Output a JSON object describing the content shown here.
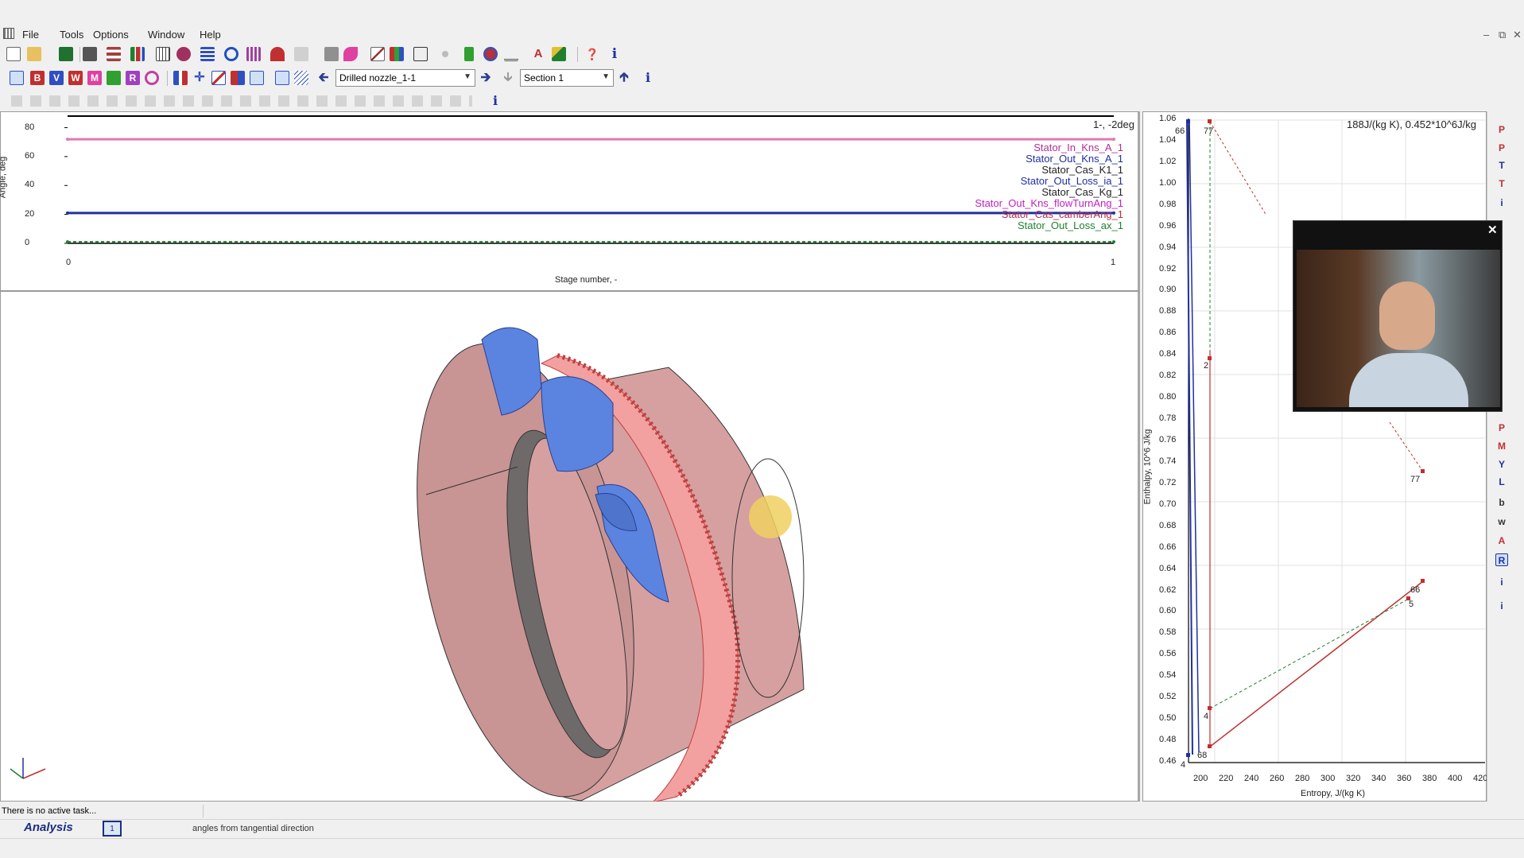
{
  "menu": {
    "file": "File",
    "tools": "Tools",
    "options": "Options",
    "window": "Window",
    "help": "Help"
  },
  "toolbar2": {
    "model_select": "Drilled nozzle_1-1",
    "section_select": "Section 1"
  },
  "top_chart": {
    "ylabel": "Angle, deg",
    "xlabel": "Stage number, -",
    "corner_label": "1-, -2deg",
    "y_ticks": [
      "80",
      "60",
      "40",
      "20",
      "0"
    ],
    "x_ticks": [
      "0",
      "1"
    ],
    "legend": [
      {
        "label": "Stator_In_Kns_A_1",
        "color": "#b03090"
      },
      {
        "label": "Stator_Out_Kns_A_1",
        "color": "#2030a0"
      },
      {
        "label": "Stator_Cas_K1_1",
        "color": "#222222"
      },
      {
        "label": "Stator_Out_Loss_ia_1",
        "color": "#2030a0"
      },
      {
        "label": "Stator_Cas_Kg_1",
        "color": "#222222"
      },
      {
        "label": "Stator_Out_Kns_flowTurnAng_1",
        "color": "#c020c0"
      },
      {
        "label": "Stator_Cas_camberAng_1",
        "color": "#b03050"
      },
      {
        "label": "Stator_Out_Loss_ax_1",
        "color": "#208030"
      }
    ]
  },
  "chart_data": {
    "type": "line",
    "title": "",
    "xlabel": "Stage number, -",
    "ylabel": "Angle, deg",
    "xlim": [
      0,
      1
    ],
    "ylim": [
      0,
      88
    ],
    "series": [
      {
        "name": "Stator_In_Kns_A_1",
        "x": [
          0,
          1
        ],
        "values": [
          72,
          72
        ],
        "color": "#e07ab0"
      },
      {
        "name": "Stator_Out_Kns_A_1",
        "x": [
          0,
          1
        ],
        "values": [
          21,
          21
        ],
        "color": "#2030a0"
      },
      {
        "name": "Stator_Out_Loss_ax_1",
        "x": [
          0,
          1
        ],
        "values": [
          1,
          1
        ],
        "color": "#208030"
      }
    ]
  },
  "hs_chart": {
    "ylabel": "Enthalpy, 10^6 J/kg",
    "xlabel": "Entropy, J/(kg K)",
    "corner_label": "188J/(kg K), 0.452*10^6J/kg",
    "y_ticks": [
      "1.06",
      "1.04",
      "1.02",
      "1.00",
      "0.98",
      "0.96",
      "0.94",
      "0.92",
      "0.90",
      "0.88",
      "0.86",
      "0.84",
      "0.82",
      "0.80",
      "0.78",
      "0.76",
      "0.74",
      "0.72",
      "0.70",
      "0.68",
      "0.66",
      "0.64",
      "0.62",
      "0.60",
      "0.58",
      "0.56",
      "0.54",
      "0.52",
      "0.50",
      "0.48",
      "0.46"
    ],
    "x_ticks": [
      "200",
      "220",
      "240",
      "260",
      "280",
      "300",
      "320",
      "340",
      "360",
      "380",
      "400",
      "420"
    ],
    "x_first_label": "4",
    "point_labels": {
      "p77a": "77",
      "p66a": "66",
      "p2": "2",
      "p77b": "77",
      "p5": "5",
      "p66b": "66",
      "p4": "4",
      "p68": "68"
    }
  },
  "side_icons": [
    "P",
    "P",
    "T",
    "T",
    "i",
    "P",
    "M",
    "Y",
    "L",
    "b",
    "w",
    "A",
    "R",
    "i",
    "i"
  ],
  "status": {
    "message": "There is no active task...",
    "tab_label": "Analysis",
    "tab_number": "1",
    "hint": "angles  from tangential direction"
  },
  "video": {
    "close_glyph": "✕"
  },
  "colors": {
    "accent": "#2030a0",
    "casing": "#d6a0a0",
    "blades": "#f3a0a0",
    "nozzle": "#5b84e0",
    "cursor": "#f0d060"
  }
}
